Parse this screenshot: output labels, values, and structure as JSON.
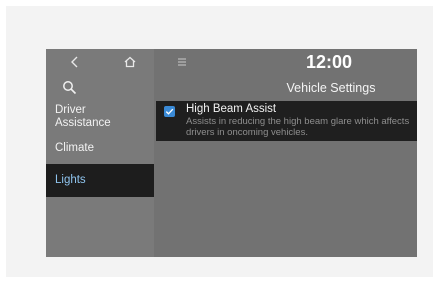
{
  "topbar": {
    "back_icon": "chevron-left-icon",
    "home_icon": "home-icon",
    "menu_icon": "menu-icon",
    "clock": "12:00"
  },
  "search_icon": "search-icon",
  "page_title": "Vehicle Settings",
  "nav": {
    "items": [
      {
        "label": "Driver\nAssistance",
        "selected": false
      },
      {
        "label": "Climate",
        "selected": false
      },
      {
        "label": "Lights",
        "selected": true
      }
    ]
  },
  "setting": {
    "checked": true,
    "title": "High Beam Assist",
    "description": "Assists in reducing the high beam glare which affects drivers in oncoming vehicles."
  },
  "colors": {
    "accent": "#3a8ad6",
    "selected_text": "#8fc4ee",
    "background": "#727272",
    "row_background": "#1f1f1f"
  }
}
